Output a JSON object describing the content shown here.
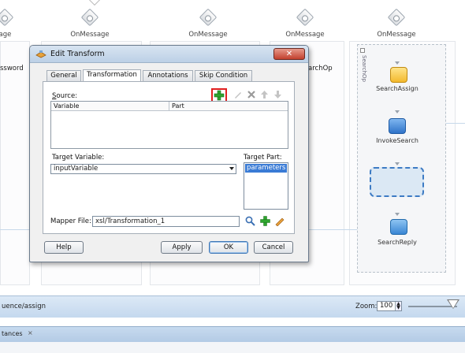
{
  "canvas": {
    "onmessage_labels": [
      "ssage",
      "OnMessage",
      "OnMessage",
      "OnMessage",
      "OnMessage"
    ],
    "partial_labels": {
      "left_password": "ssword",
      "right_searchop": "archOp"
    },
    "scope_label": "SearchOp",
    "activities": {
      "search_assign": "SearchAssign",
      "invoke_search": "InvokeSearch",
      "search_reply": "SearchReply"
    }
  },
  "dialog": {
    "title": "Edit Transform",
    "close_symbol": "✕",
    "tabs": [
      "General",
      "Transformation",
      "Annotations",
      "Skip Condition"
    ],
    "active_tab": "Transformation",
    "source": {
      "label": "Source:",
      "columns": [
        "Variable",
        "Part"
      ],
      "rows": []
    },
    "target_variable": {
      "label": "Target Variable:",
      "value": "inputVariable"
    },
    "target_part": {
      "label": "Target Part:",
      "items": [
        "parameters"
      ],
      "selected": "parameters"
    },
    "mapper_file": {
      "label": "Mapper File:",
      "value": "xsl/Transformation_1"
    },
    "buttons": {
      "help": "Help",
      "apply": "Apply",
      "ok": "OK",
      "cancel": "Cancel"
    }
  },
  "statusbar": {
    "breadcrumb": "uence/assign",
    "zoom_label": "Zoom:",
    "zoom_value": "100"
  },
  "bottom_tab": {
    "label": "tances",
    "close": "×"
  },
  "colors": {
    "highlight_red": "#e02020",
    "add_green": "#2fa52f",
    "selection_blue": "#3a7bd5",
    "status_blue": "#c4d8ee"
  }
}
